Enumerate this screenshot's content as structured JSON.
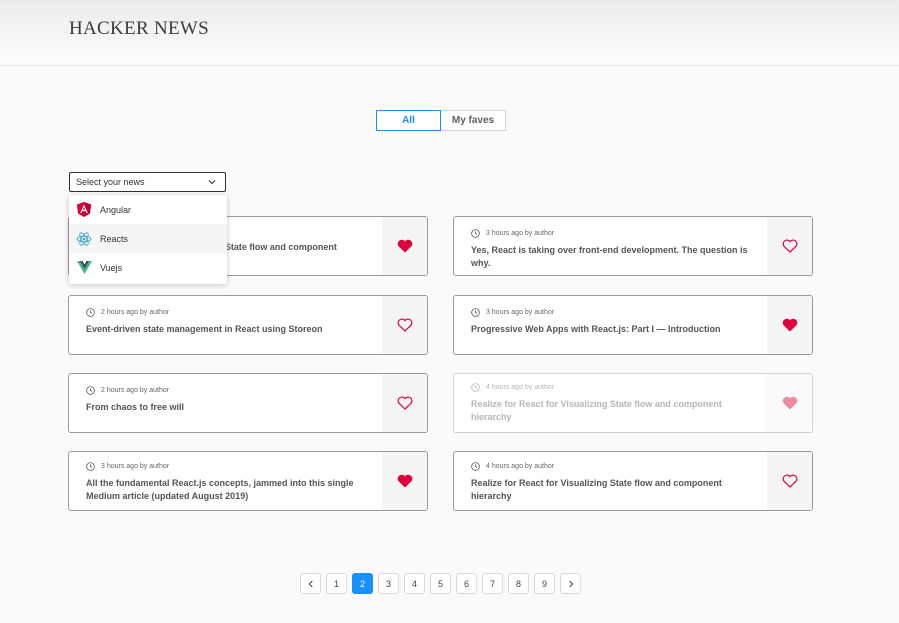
{
  "app": {
    "title": "HACKER NEWS"
  },
  "tabs": [
    {
      "label": "All"
    },
    {
      "label": "My faves"
    }
  ],
  "select": {
    "placeholder": "Select your news",
    "options": [
      {
        "label": "Angular",
        "icon": "angular-icon"
      },
      {
        "label": "Reacts",
        "icon": "react-icon"
      },
      {
        "label": "Vuejs",
        "icon": "vue-icon"
      }
    ]
  },
  "colors": {
    "accent": "#1890ff",
    "heart": "#e0003c",
    "heart_faded": "#f08aa0"
  },
  "news": [
    {
      "meta": "",
      "title": "Realize for React for Visualizing State flow and component hierarchy",
      "faved": true
    },
    {
      "meta": "3 hours ago by author",
      "title": "Yes, React is taking over front-end development. The question is why.",
      "faved": false
    },
    {
      "meta": "2 hours ago by author",
      "title": "Event-driven state management in React using Storeon",
      "faved": false
    },
    {
      "meta": "3 hours ago by author",
      "title": "Progressive Web Apps with React.js: Part I — Introduction",
      "faved": true
    },
    {
      "meta": "2 hours ago by author",
      "title": "From chaos to free will",
      "faved": false
    },
    {
      "meta": "4 hours ago by author",
      "title": "Realize for React for Visualizing State flow and component hierarchy",
      "faved": true
    },
    {
      "meta": "3 hours ago by author",
      "title": "All the fundamental React.js concepts, jammed into this single Medium article (updated August 2019)",
      "faved": true
    },
    {
      "meta": "4 hours ago by author",
      "title": "Realize for React for Visualizing State flow and component hierarchy",
      "faved": false
    }
  ],
  "pagination": {
    "prev": "<",
    "next": ">",
    "pages": [
      "1",
      "2",
      "3",
      "4",
      "5",
      "6",
      "7",
      "8",
      "9"
    ],
    "current": "2"
  }
}
